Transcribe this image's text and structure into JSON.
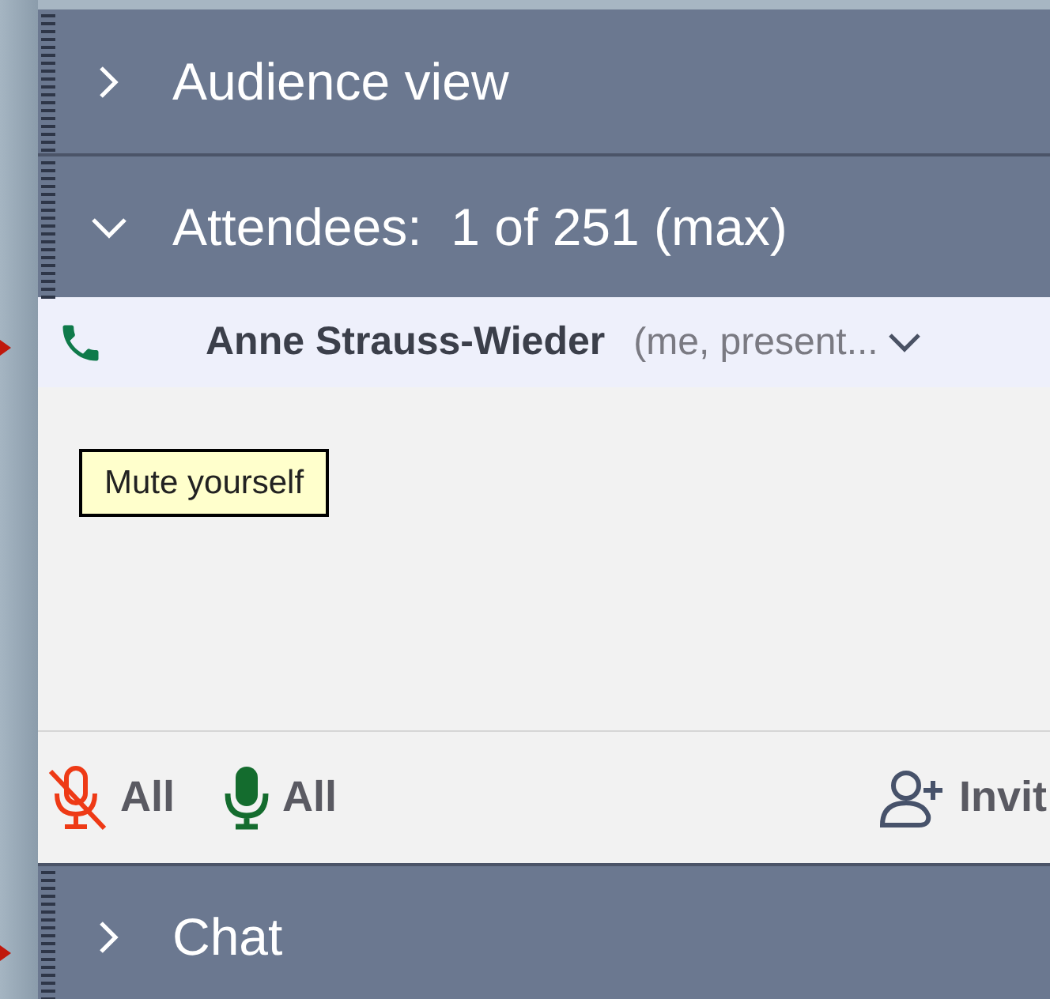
{
  "sections": [
    {
      "title": "Audience view",
      "expanded": false
    },
    {
      "title": "Attendees:  1 of 251 (max)",
      "expanded": true,
      "attendees": [
        {
          "name": "Anne Strauss-Wieder",
          "detail": "(me, present..."
        }
      ],
      "tooltip": "Mute yourself",
      "actions": [
        {
          "kind": "mute-all",
          "label": "All"
        },
        {
          "kind": "unmute-all",
          "label": "All"
        },
        {
          "kind": "invite",
          "label": "Invit"
        }
      ]
    },
    {
      "title": "Chat",
      "expanded": false
    }
  ]
}
